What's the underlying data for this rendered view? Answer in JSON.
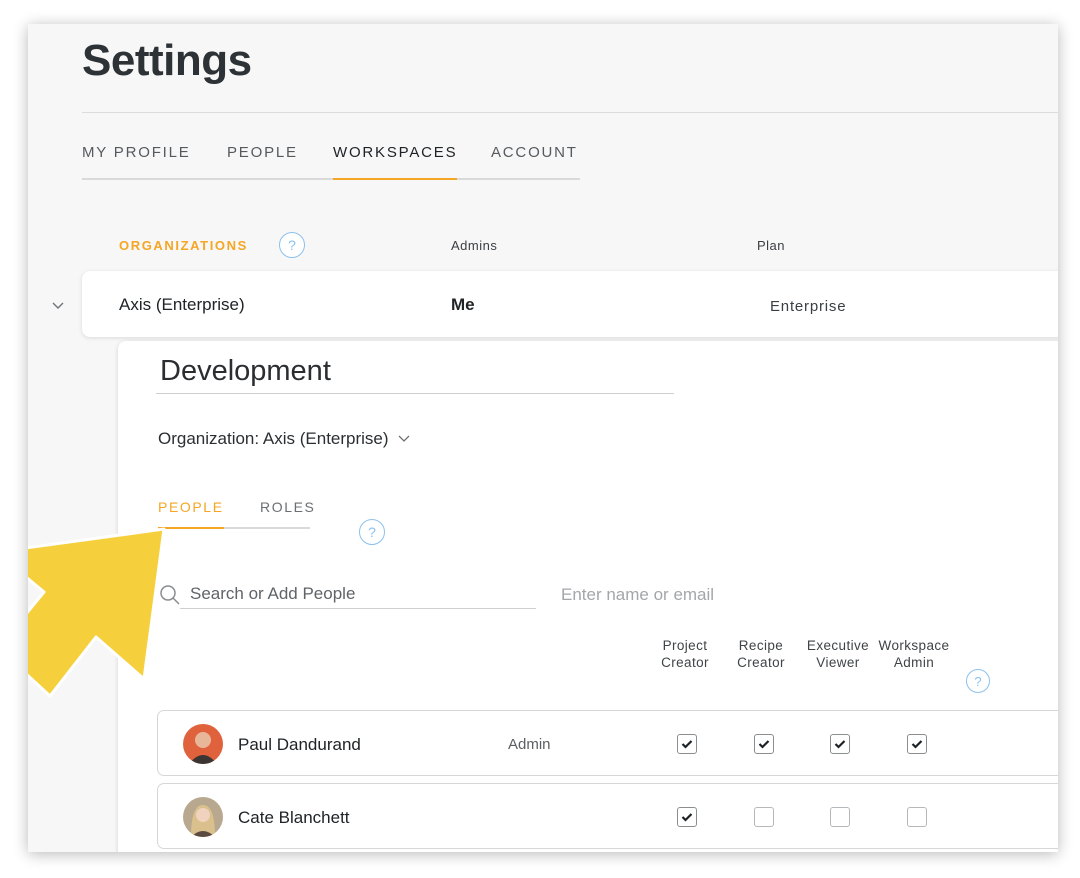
{
  "page": {
    "title": "Settings"
  },
  "tabs": [
    {
      "label": "MY PROFILE",
      "active": false
    },
    {
      "label": "PEOPLE",
      "active": false
    },
    {
      "label": "WORKSPACES",
      "active": true
    },
    {
      "label": "ACCOUNT",
      "active": false
    }
  ],
  "organizations": {
    "header_label": "ORGANIZATIONS",
    "help_icon": "?",
    "col_admins": "Admins",
    "col_plan": "Plan",
    "row": {
      "name": "Axis (Enterprise)",
      "admins": "Me",
      "plan": "Enterprise"
    }
  },
  "workspace": {
    "name": "Development",
    "organization_select": "Organization: Axis (Enterprise)",
    "subtabs": [
      {
        "label": "PEOPLE",
        "active": true
      },
      {
        "label": "ROLES",
        "active": false
      }
    ],
    "help_icon": "?",
    "search": {
      "placeholder": "Search or Add People",
      "hint": "Enter name or email"
    },
    "columns": [
      {
        "line1": "Project",
        "line2": "Creator"
      },
      {
        "line1": "Recipe",
        "line2": "Creator"
      },
      {
        "line1": "Executive",
        "line2": "Viewer"
      },
      {
        "line1": "Workspace",
        "line2": "Admin"
      }
    ],
    "people": [
      {
        "name": "Paul Dandurand",
        "role": "Admin",
        "permissions": [
          true,
          true,
          true,
          true
        ]
      },
      {
        "name": "Cate Blanchett",
        "role": "",
        "permissions": [
          true,
          false,
          false,
          false
        ]
      }
    ]
  },
  "colors": {
    "accent": "#f4a624",
    "help_blue": "#8cc1ee",
    "arrow_yellow": "#f5d03c"
  },
  "icons": {
    "expand": "chevron-down-icon",
    "search": "search-icon",
    "check": "check-icon",
    "callout": "arrow-callout-icon"
  }
}
